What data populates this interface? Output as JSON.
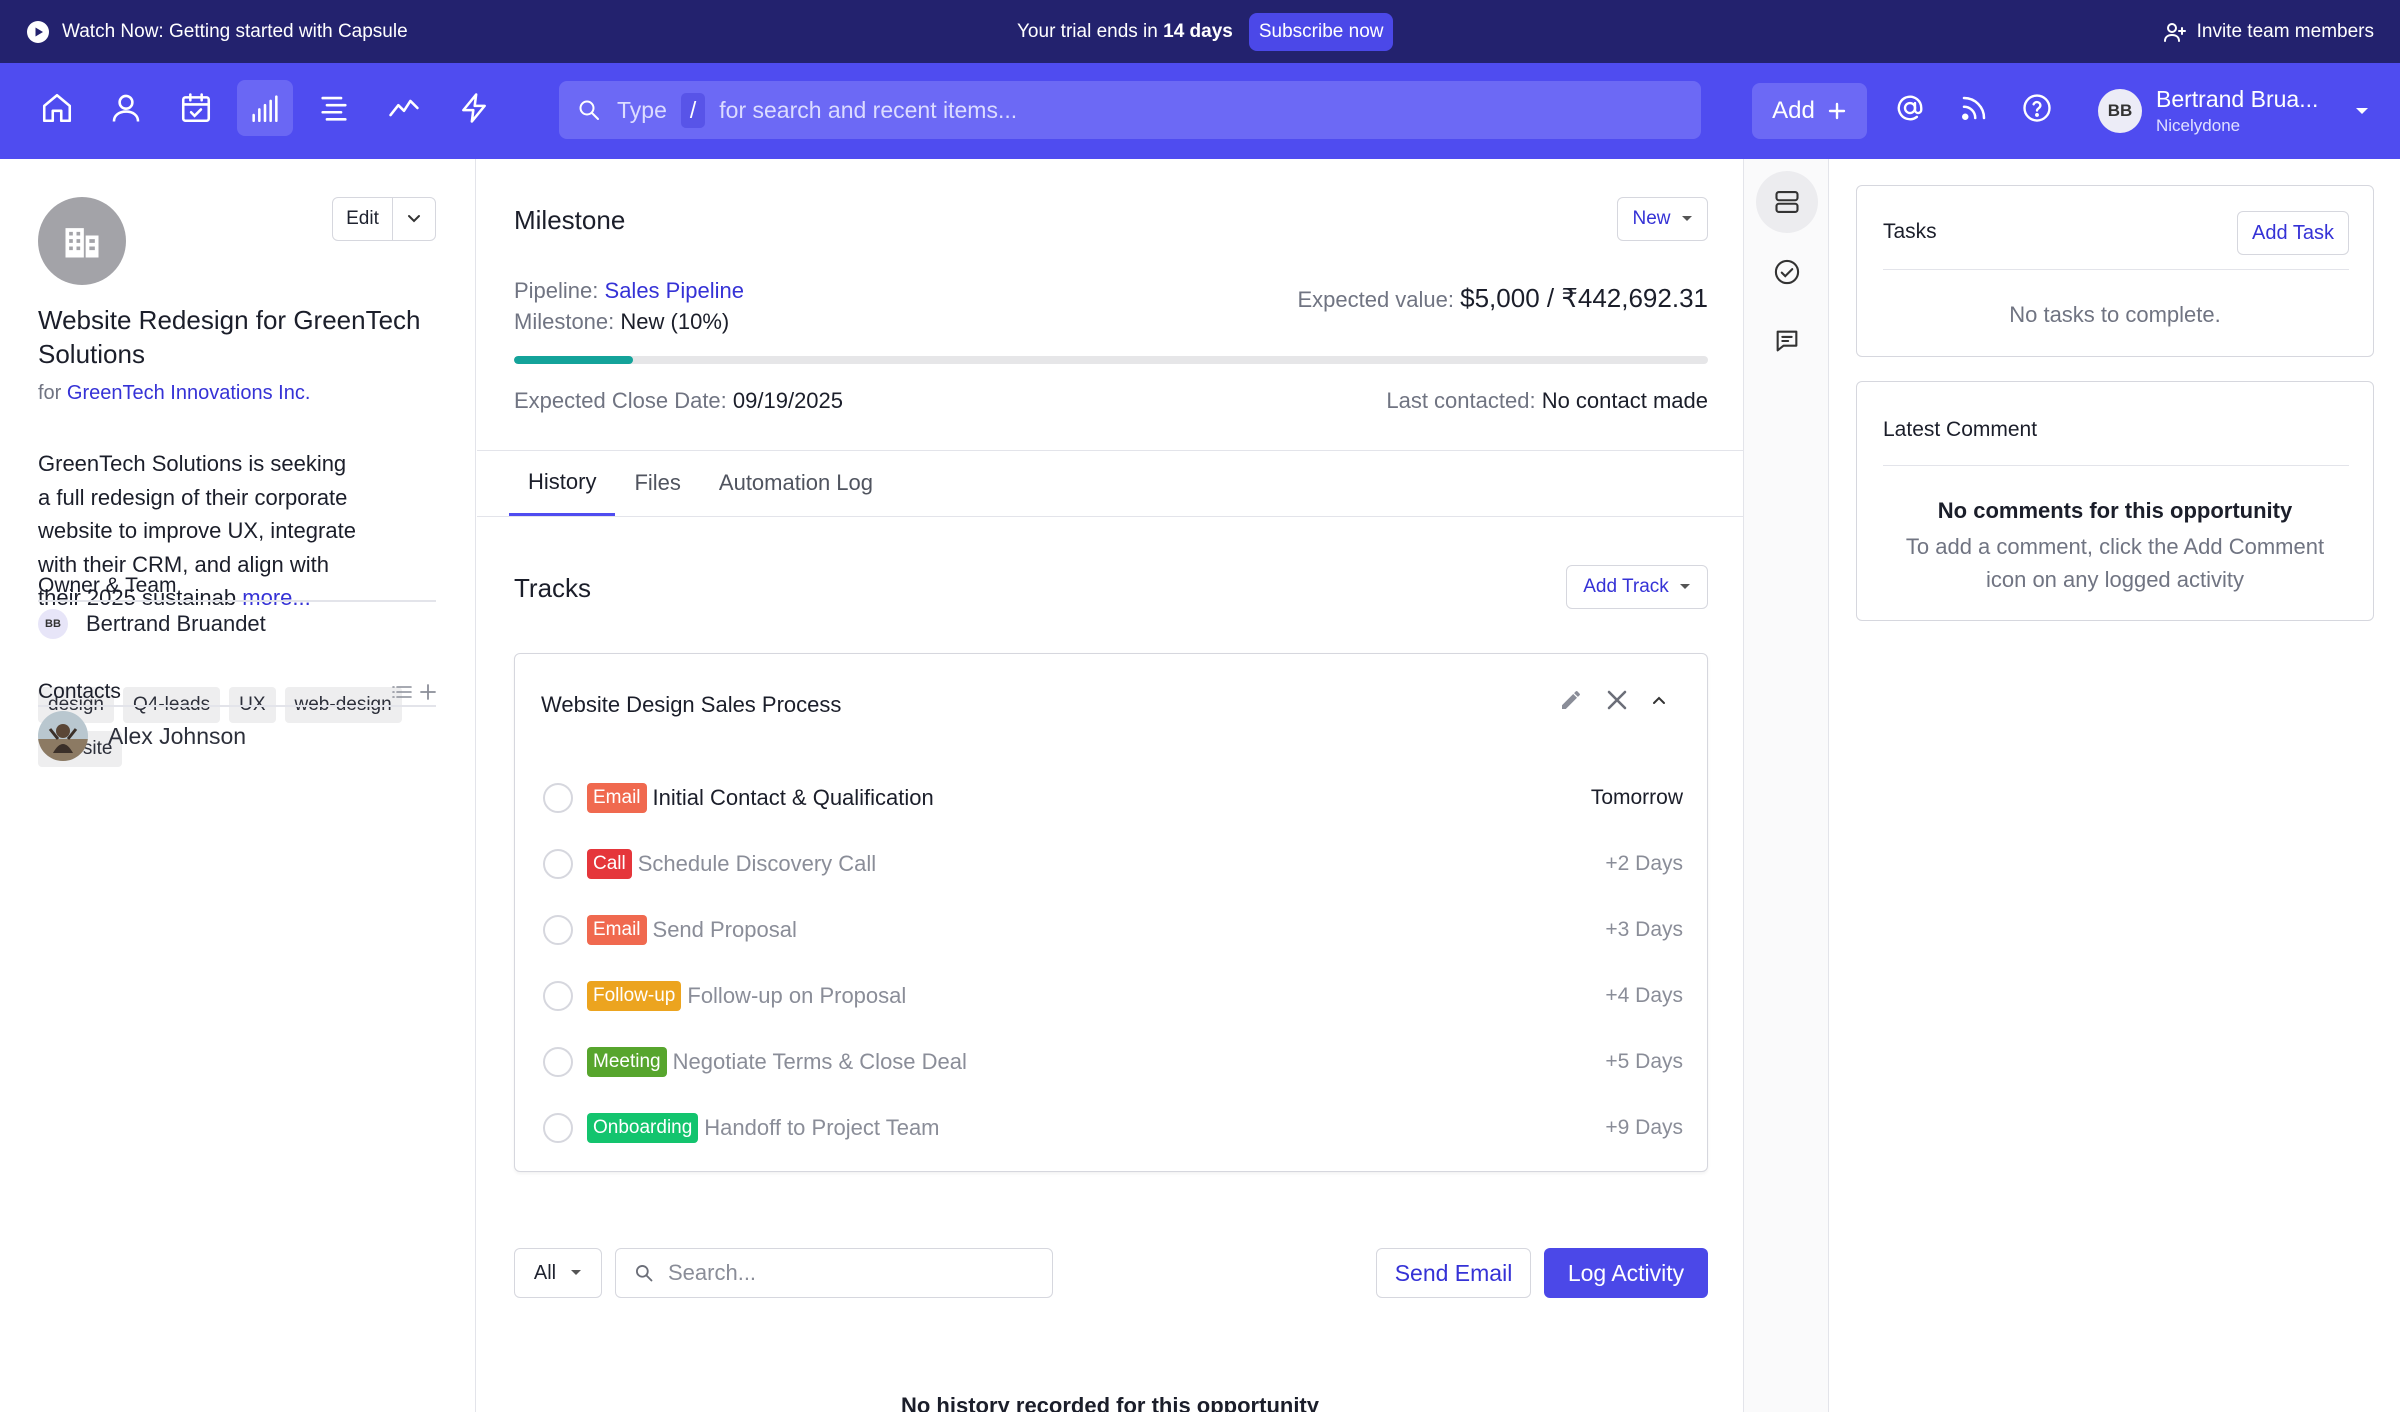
{
  "banner": {
    "watch_label": "Watch Now: Getting started with Capsule",
    "trial_prefix": "Your trial ends in",
    "trial_days": "14 days",
    "subscribe_label": "Subscribe now",
    "invite_label": "Invite team members"
  },
  "nav": {
    "icons": [
      "home-icon",
      "person-icon",
      "calendar-icon",
      "pipeline-icon",
      "projects-icon",
      "reports-icon",
      "workflow-icon"
    ],
    "active": "pipeline-icon",
    "search_type": "Type",
    "search_kbd": "/",
    "search_rest": "for search and recent items...",
    "add_label": "Add",
    "user_initials": "BB",
    "user_name": "Bertrand Brua...",
    "user_org": "Nicelydone"
  },
  "opportunity": {
    "edit_label": "Edit",
    "title": "Website Redesign for GreenTech Solutions",
    "for_prefix": "for",
    "company": "GreenTech Innovations Inc.",
    "description": "GreenTech Solutions is seeking a full redesign of their corporate website to improve UX, integrate with their CRM, and align with their 2025 sustainab",
    "more_label": "more...",
    "tags": [
      "design",
      "Q4-leads",
      "UX",
      "web-design",
      "website"
    ],
    "owner_heading": "Owner & Team",
    "owner_initials": "BB",
    "owner_name": "Bertrand Bruandet",
    "contacts_heading": "Contacts",
    "contact_name": "Alex Johnson"
  },
  "milestone": {
    "heading": "Milestone",
    "status_button": "New",
    "pipeline_label": "Pipeline:",
    "pipeline_value": "Sales Pipeline",
    "milestone_label": "Milestone:",
    "milestone_value": "New (10%)",
    "progress": 0.1,
    "expected_value_label": "Expected value:",
    "expected_value": "$5,000 / ₹442,692.31",
    "close_date_label": "Expected Close Date:",
    "close_date": "09/19/2025",
    "last_contacted_label": "Last contacted:",
    "last_contacted": "No contact made"
  },
  "tabs": [
    {
      "label": "History",
      "active": true
    },
    {
      "label": "Files",
      "active": false
    },
    {
      "label": "Automation Log",
      "active": false
    }
  ],
  "tracks": {
    "heading": "Tracks",
    "add_track_label": "Add Track",
    "track_name": "Website Design Sales Process",
    "tasks": [
      {
        "badge": "Email",
        "color": "#f0694f",
        "name": "Initial Contact & Qualification",
        "due": "Tomorrow"
      },
      {
        "badge": "Call",
        "color": "#e5363b",
        "name": "Schedule Discovery Call",
        "due": "+2 Days"
      },
      {
        "badge": "Email",
        "color": "#f0694f",
        "name": "Send Proposal",
        "due": "+3 Days"
      },
      {
        "badge": "Follow-up",
        "color": "#eca41f",
        "name": "Follow-up on Proposal",
        "due": "+4 Days"
      },
      {
        "badge": "Meeting",
        "color": "#57a52d",
        "name": "Negotiate Terms & Close Deal",
        "due": "+5 Days"
      },
      {
        "badge": "Onboarding",
        "color": "#13c46e",
        "name": "Handoff to Project Team",
        "due": "+9 Days"
      }
    ]
  },
  "history": {
    "filter_value": "All",
    "search_placeholder": "Search...",
    "send_email_label": "Send Email",
    "log_activity_label": "Log Activity",
    "empty_message": "No history recorded for this opportunity"
  },
  "tasks_card": {
    "heading": "Tasks",
    "add_task_label": "Add Task",
    "empty_message": "No tasks to complete."
  },
  "comment_card": {
    "heading": "Latest Comment",
    "empty_title": "No comments for this opportunity",
    "empty_line1": "To add a comment, click the Add Comment",
    "empty_line2": "icon on any logged activity"
  },
  "colors": {
    "banner": "#23226e",
    "nav": "#4f4cf0",
    "accent": "#4b48e8",
    "link": "#3532d6",
    "progress": "#14a39a"
  }
}
